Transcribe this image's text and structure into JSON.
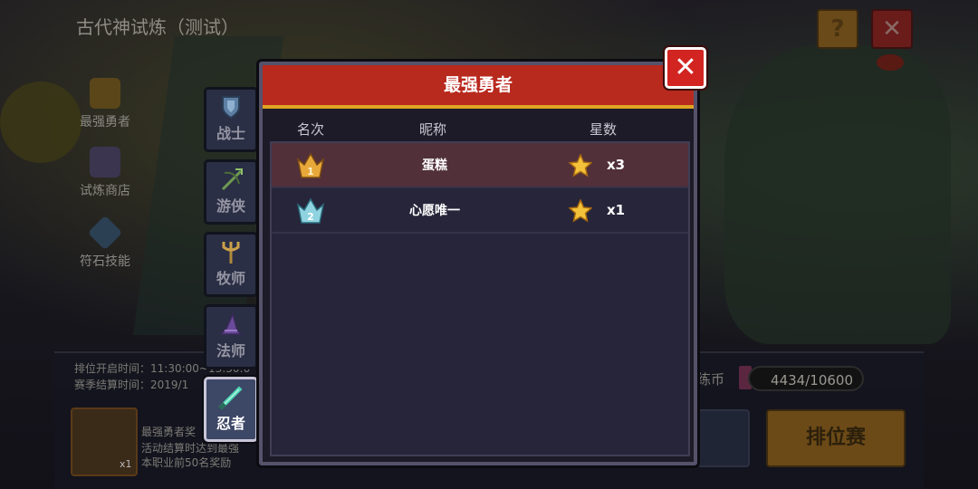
{
  "background": {
    "title": "古代神试炼（测试）",
    "help_label": "?",
    "close_label": "✕",
    "nav": [
      {
        "label": "最强勇者",
        "icon": "trophy-icon"
      },
      {
        "label": "试炼商店",
        "icon": "shop-icon"
      },
      {
        "label": "符石技能",
        "icon": "rune-icon"
      }
    ],
    "info_line1": "排位开启时间：11:30:00~13:30:0",
    "info_line2": "赛季结算时间：2019/1",
    "reward_title": "最强勇者奖",
    "reward_line1": "活动结算时达到最强",
    "reward_line2": "本职业前50名奖励",
    "reward_count": "x1",
    "coin_label": "练币",
    "coin_value": "4434/10600",
    "rank_button": "排位赛"
  },
  "tabs": [
    {
      "label": "战士",
      "icon": "shield-icon",
      "active": false
    },
    {
      "label": "游侠",
      "icon": "bow-icon",
      "active": false
    },
    {
      "label": "牧师",
      "icon": "staff-icon",
      "active": false
    },
    {
      "label": "法师",
      "icon": "wizard-hat-icon",
      "active": false
    },
    {
      "label": "忍者",
      "icon": "blade-icon",
      "active": true
    }
  ],
  "modal": {
    "title": "最强勇者",
    "close_label": "✕",
    "columns": {
      "rank": "名次",
      "name": "昵称",
      "stars": "星数"
    },
    "rows": [
      {
        "rank": "1",
        "name": "蛋糕",
        "stars": "x3",
        "crown_color": "#e8a93a"
      },
      {
        "rank": "2",
        "name": "心愿唯一",
        "stars": "x1",
        "crown_color": "#8fd3e0"
      }
    ]
  }
}
